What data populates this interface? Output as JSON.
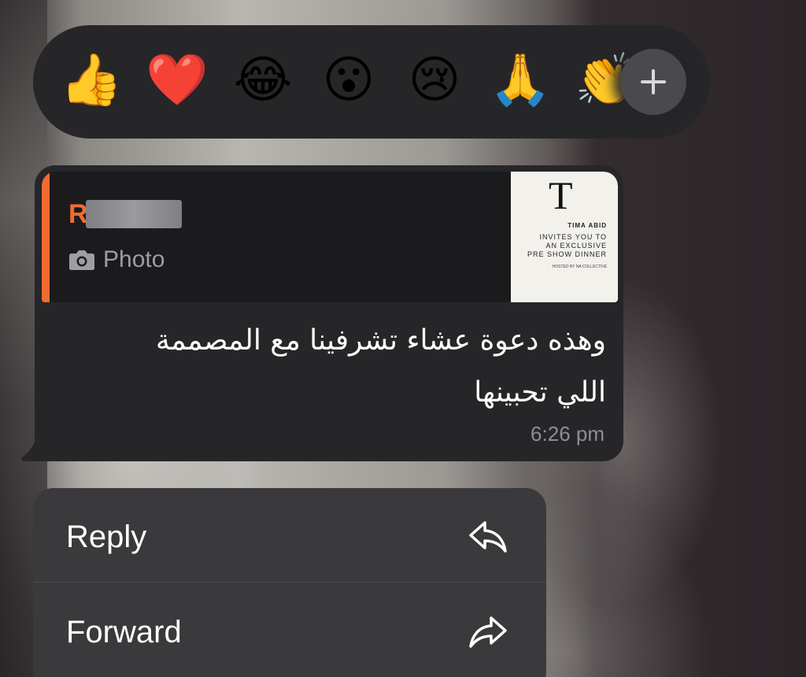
{
  "reactions": {
    "items": [
      {
        "emoji": "👍",
        "name": "thumbs-up"
      },
      {
        "emoji": "❤️",
        "name": "red-heart"
      },
      {
        "emoji": "😂",
        "name": "tears-of-joy"
      },
      {
        "emoji": "😮",
        "name": "face-open-mouth"
      },
      {
        "emoji": "😢",
        "name": "crying-face"
      },
      {
        "emoji": "🙏",
        "name": "folded-hands"
      },
      {
        "emoji": "👏",
        "name": "clapping-hands"
      }
    ],
    "more_icon": "plus-icon"
  },
  "message": {
    "quote": {
      "sender_initial": "R",
      "type_icon": "camera-icon",
      "type_label": "Photo",
      "accent_color": "#f26b33",
      "thumbnail": {
        "logo": "T",
        "name": "TIMA ABID",
        "lines": [
          "INVITES YOU TO",
          "AN EXCLUSIVE",
          "PRE SHOW DINNER"
        ],
        "host_line": "HOSTED BY NA COLLECTIVE"
      }
    },
    "text_line1": "وهذه دعوة عشاء تشرفينا مع المصممة",
    "text_line2": "اللي تحبينها",
    "time": "6:26 pm"
  },
  "menu": {
    "items": [
      {
        "label": "Reply",
        "icon": "reply-icon"
      },
      {
        "label": "Forward",
        "icon": "forward-icon"
      }
    ]
  }
}
